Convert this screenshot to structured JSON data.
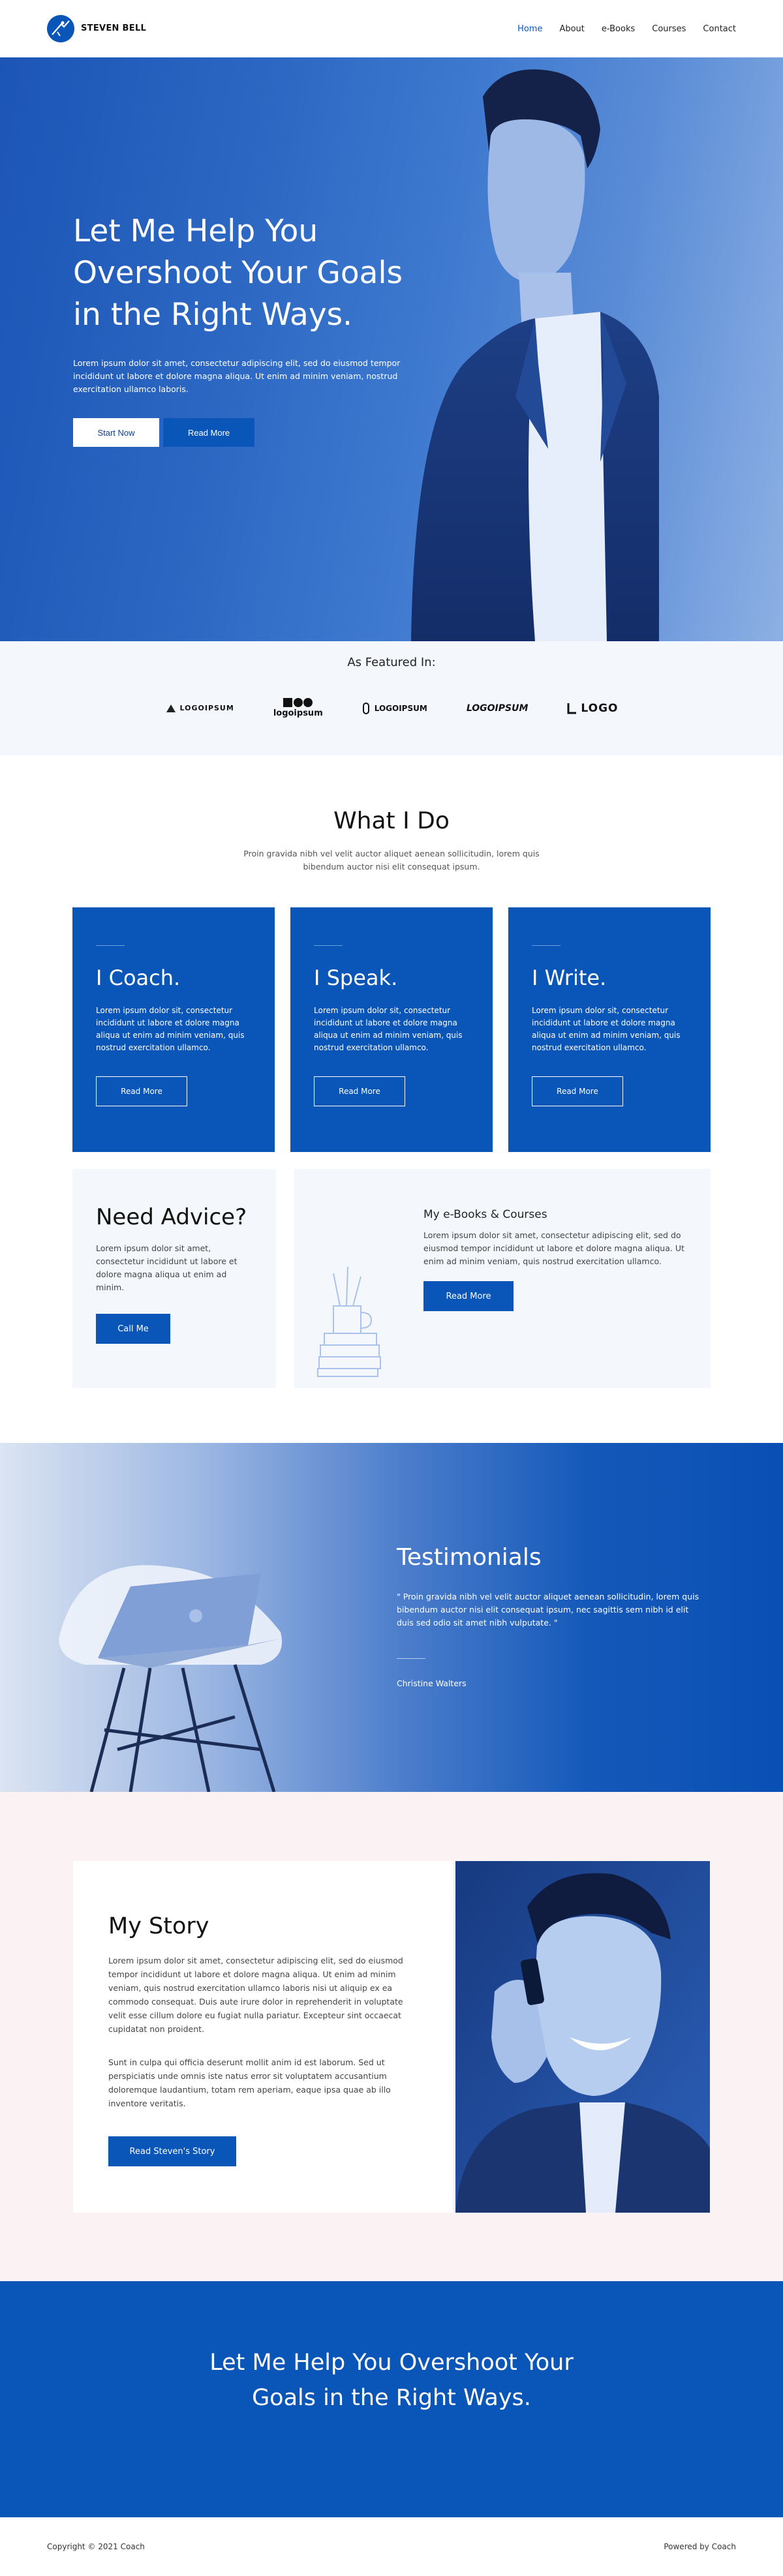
{
  "brand": {
    "name": "STEVEN BELL",
    "tagline": ""
  },
  "nav": {
    "items": [
      {
        "label": "Home",
        "active": true
      },
      {
        "label": "About",
        "active": false
      },
      {
        "label": "e-Books",
        "active": false
      },
      {
        "label": "Courses",
        "active": false
      },
      {
        "label": "Contact",
        "active": false
      }
    ]
  },
  "hero": {
    "title": "Let Me Help You Overshoot Your Goals in the Right Ways.",
    "text": "Lorem ipsum dolor sit amet, consectetur adipiscing elit, sed do eiusmod tempor incididunt ut labore et dolore magna aliqua. Ut enim ad minim veniam, nostrud exercitation ullamco laboris.",
    "primary_button": "Start Now",
    "secondary_button": "Read More"
  },
  "featured": {
    "heading": "As Featured In:",
    "logos": [
      "LOGOIPSUM",
      "logoipsum",
      "LOGOIPSUM",
      "LOGOIPSUM",
      "LOGO"
    ]
  },
  "what_i_do": {
    "title": "What I Do",
    "subtitle": "Proin gravida nibh vel velit auctor aliquet aenean sollicitudin, lorem quis bibendum auctor nisi elit consequat ipsum.",
    "cards": [
      {
        "title": "I Coach.",
        "text": "Lorem ipsum dolor sit, consectetur incididunt ut labore et dolore magna aliqua ut enim ad minim veniam, quis nostrud exercitation ullamco.",
        "button": "Read More"
      },
      {
        "title": "I Speak.",
        "text": "Lorem ipsum dolor sit, consectetur incididunt ut labore et dolore magna aliqua ut enim ad minim veniam, quis nostrud exercitation ullamco.",
        "button": "Read More"
      },
      {
        "title": "I Write.",
        "text": "Lorem ipsum dolor sit, consectetur incididunt ut labore et dolore magna aliqua ut enim ad minim veniam, quis nostrud exercitation ullamco.",
        "button": "Read More"
      }
    ],
    "advice": {
      "title": "Need Advice?",
      "text": "Lorem ipsum dolor sit amet, consectetur incididunt ut labore et dolore magna aliqua ut enim ad minim.",
      "button": "Call Me"
    },
    "ebooks": {
      "title": "My e-Books & Courses",
      "text": "Lorem ipsum dolor sit amet, consectetur adipiscing elit, sed do eiusmod tempor incididunt ut labore et dolore magna aliqua. Ut enim ad minim veniam, quis nostrud exercitation ullamco.",
      "button": "Read More"
    }
  },
  "testimonials": {
    "title": "Testimonials",
    "quote": "\" Proin gravida nibh vel velit auctor aliquet aenean sollicitudin, lorem quis bibendum auctor nisi elit consequat ipsum, nec sagittis sem nibh id elit duis sed odio sit amet nibh vulputate. \"",
    "author": "Christine Walters"
  },
  "story": {
    "title": "My Story",
    "paragraph1": "Lorem ipsum dolor sit amet, consectetur adipiscing elit, sed do eiusmod tempor incididunt ut labore et dolore magna aliqua. Ut enim ad minim veniam, quis nostrud exercitation ullamco laboris nisi ut aliquip ex ea commodo consequat. Duis aute irure dolor in reprehenderit in voluptate velit esse cillum dolore eu fugiat nulla pariatur. Excepteur sint occaecat cupidatat non proident.",
    "paragraph2": "Sunt in culpa qui officia deserunt mollit anim id est laborum. Sed ut perspiciatis unde omnis iste natus error sit voluptatem accusantium doloremque laudantium, totam rem aperiam, eaque ipsa quae ab illo inventore veritatis.",
    "button": "Read Steven's Story"
  },
  "cta": {
    "title": "Let Me Help You Overshoot Your Goals in the Right Ways."
  },
  "footer": {
    "copyright": "Copyright © 2021 Coach",
    "powered": "Powered by Coach"
  },
  "colors": {
    "primary": "#0a56b8",
    "light_bg": "#f4f7fb",
    "story_bg": "#fbf3f3"
  }
}
